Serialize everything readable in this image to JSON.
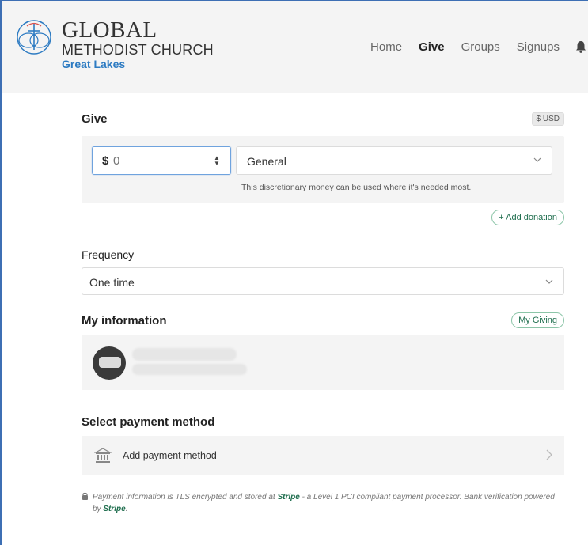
{
  "brand": {
    "line1": "GLOBAL",
    "line2": "METHODIST CHURCH",
    "line3": "Great Lakes"
  },
  "nav": {
    "items": [
      {
        "label": "Home",
        "active": false
      },
      {
        "label": "Give",
        "active": true
      },
      {
        "label": "Groups",
        "active": false
      },
      {
        "label": "Signups",
        "active": false
      }
    ],
    "bell_icon": "bell-icon"
  },
  "give": {
    "title": "Give",
    "currency": "$ USD",
    "amount_symbol": "$",
    "amount_placeholder": "0",
    "fund": "General",
    "fund_description": "This discretionary money can be used where it's needed most.",
    "add_donation": "+ Add donation"
  },
  "frequency": {
    "title": "Frequency",
    "value": "One time"
  },
  "my_info": {
    "title": "My information",
    "my_giving": "My Giving"
  },
  "payment": {
    "title": "Select payment method",
    "add_label": "Add payment method"
  },
  "security": {
    "text_before": "Payment information is TLS encrypted and stored at ",
    "stripe1": "Stripe",
    "text_middle": " - a Level 1 PCI compliant payment processor. Bank verification powered by ",
    "stripe2": "Stripe",
    "text_end": "."
  },
  "colors": {
    "accent_blue": "#2d7bc2",
    "accent_green": "#1f6e4e",
    "frame": "#3d6fb4"
  }
}
